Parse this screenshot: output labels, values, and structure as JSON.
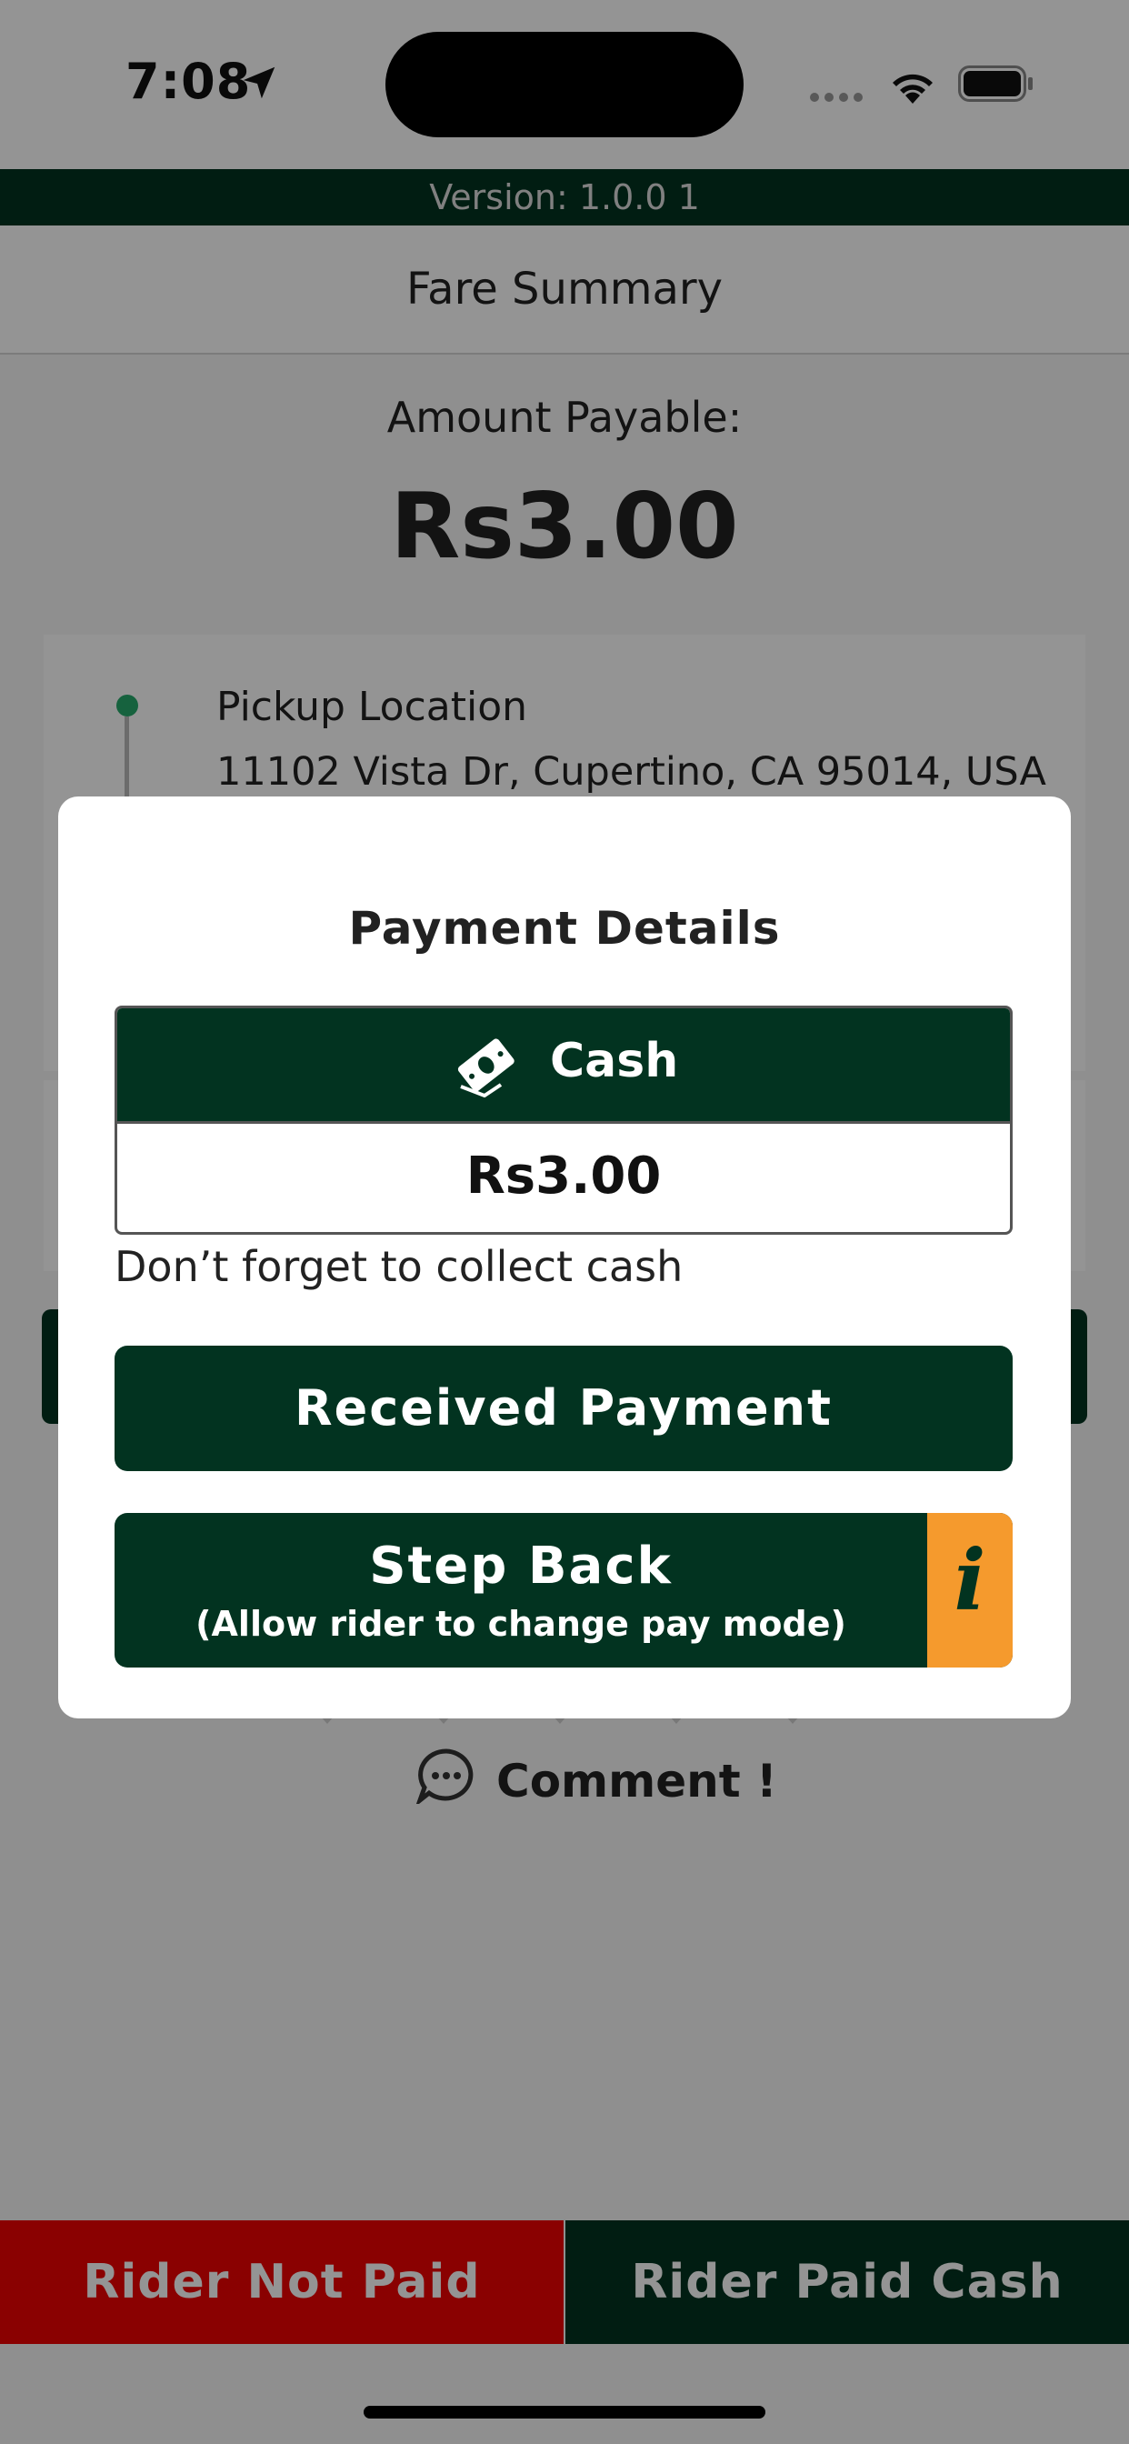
{
  "status_bar": {
    "time": "7:08",
    "icons": [
      "location-arrow-icon",
      "signal-dots-icon",
      "wifi-icon",
      "battery-icon"
    ]
  },
  "app": {
    "version": "Version: 1.0.0 1",
    "header_title": "Fare Summary"
  },
  "fare": {
    "amount_label": "Amount Payable:",
    "amount_value": "Rs3.00"
  },
  "trip": {
    "pickup_title": "Pickup Location",
    "pickup_address": "11102 Vista Dr, Cupertino, CA 95014, USA"
  },
  "feedback": {
    "comment_label": "Comment !",
    "icons": [
      "star-icon",
      "comment-icon"
    ]
  },
  "bottom_actions": {
    "not_paid_label": "Rider Not Paid",
    "paid_cash_label": "Rider Paid Cash"
  },
  "modal": {
    "title": "Payment Details",
    "payment_method": "Cash",
    "payment_amount": "Rs3.00",
    "reminder": "Don’t forget to collect cash",
    "received_label": "Received Payment",
    "step_back_label": "Step Back",
    "step_back_sub": "(Allow rider to change pay mode)",
    "info_glyph": "i",
    "icons": [
      "cash-icon",
      "info-icon"
    ]
  },
  "colors": {
    "brand_dark_green": "#023320",
    "danger_red": "#ee0202",
    "info_orange": "#f59a2d",
    "pickup_green": "#27a96b"
  }
}
